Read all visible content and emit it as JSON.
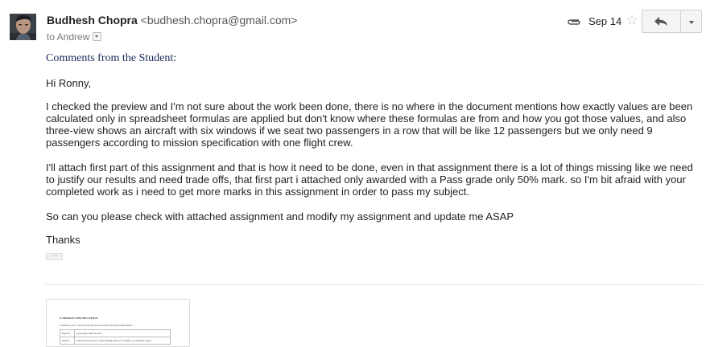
{
  "header": {
    "sender_name": "Budhesh Chopra",
    "sender_email": "<budhesh.chopra@gmail.com>",
    "to_label": "to Andrew",
    "date": "Sep 14",
    "star_glyph": "☆"
  },
  "body": {
    "comments_heading": "Comments from the Student:",
    "greeting": "Hi Ronny,",
    "paragraph1": "I checked the preview and I'm not sure about the work been done, there is no where in the document mentions how exactly values are been calculated only in spreadsheet formulas are applied but don't know where these formulas are from and how you got those values, and also three-view shows an aircraft with six windows if we seat two passengers in a row that will be like 12 passengers but we only need 9 passengers according to mission specification with one flight crew.",
    "paragraph2": "I'll attach first part of  this assignment and that is how it need to be done, even in that assignment there is a lot of things missing like we need to justify our results and need trade offs, that first part i attached only awarded with a Pass grade only 50% mark. so I'm bit afraid with your completed work as i need to get more marks in this assignment in order to pass my subject.",
    "paragraph3": "So can you please check with attached assignment and modify my assignment and update me ASAP",
    "signoff": "Thanks",
    "ellipsis": "···"
  },
  "attachment": {
    "heading": "8. MISSION SPECIFICATION",
    "intro": "A business jet for corporate and private use has the following requirements:",
    "rows": [
      {
        "label": "Payload",
        "value": "9 passenger with one pilot"
      },
      {
        "label": "Mission",
        "value": "1500 nm with at least 1 hour holding reserves for flight to an alternate airport"
      }
    ]
  },
  "icons": {
    "attachment": "paperclip-icon",
    "star": "star-icon",
    "reply": "reply-arrow-icon",
    "more": "chevron-down-icon",
    "to_details": "small-dropdown-icon"
  },
  "colors": {
    "comments_heading": "#1a2a5a",
    "button_bg": "#f5f5f5",
    "star": "#c8c8c8"
  }
}
